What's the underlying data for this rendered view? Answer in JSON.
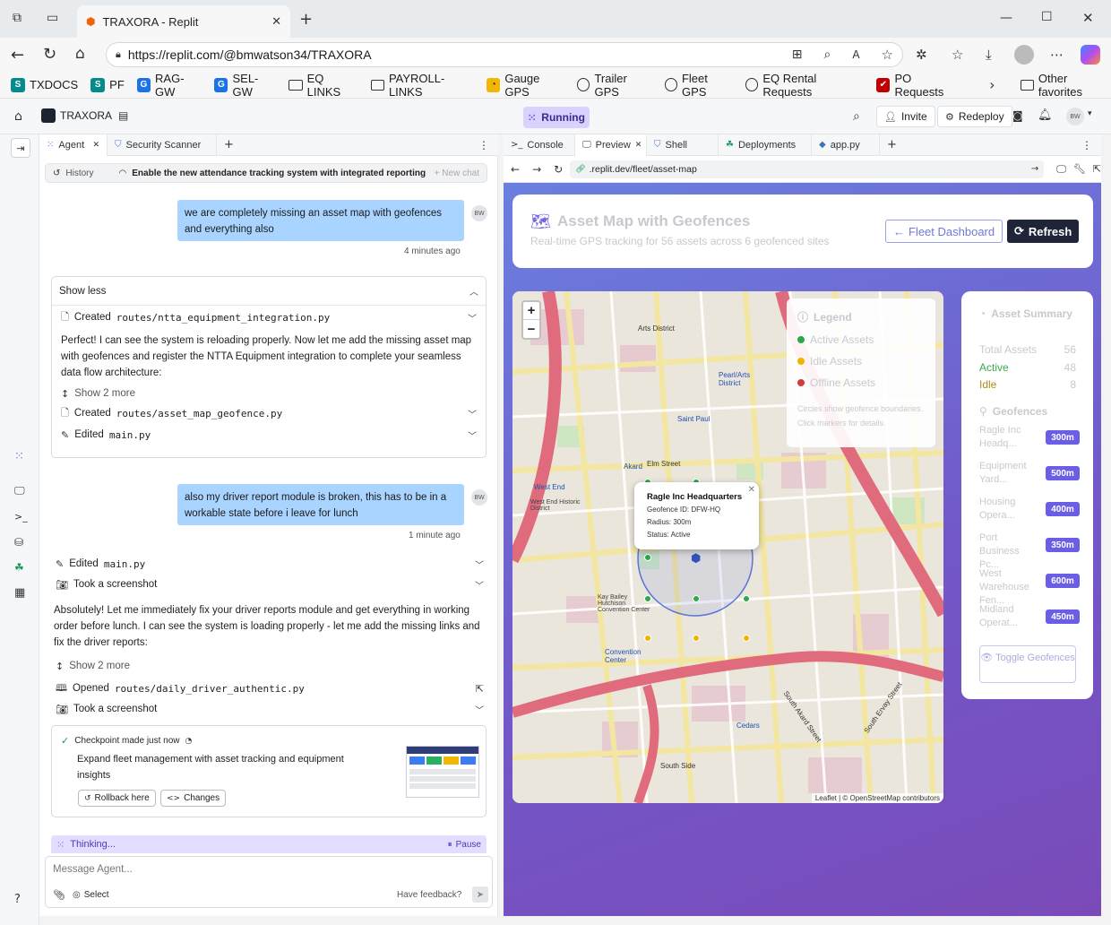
{
  "browser": {
    "tab_title": "TRAXORA - Replit",
    "url": "https://replit.com/@bmwatson34/TRAXORA",
    "favorites": [
      {
        "label": "TXDOCS",
        "icon": "sharepoint-icon"
      },
      {
        "label": "PF",
        "icon": "sharepoint-icon"
      },
      {
        "label": "RAG-GW",
        "icon": "g-icon"
      },
      {
        "label": "SEL-GW",
        "icon": "g-icon"
      },
      {
        "label": "EQ LINKS",
        "icon": "folder-icon"
      },
      {
        "label": "PAYROLL-LINKS",
        "icon": "folder-icon"
      },
      {
        "label": "Gauge GPS",
        "icon": "gauge-icon"
      },
      {
        "label": "Trailer GPS",
        "icon": "globe-icon"
      },
      {
        "label": "Fleet GPS",
        "icon": "globe-icon"
      },
      {
        "label": "EQ Rental Requests",
        "icon": "globe-icon"
      },
      {
        "label": "PO Requests",
        "icon": "po-icon"
      }
    ],
    "other_favorites": "Other favorites"
  },
  "replit": {
    "project": "TRAXORA",
    "status": "Running",
    "invite": "Invite",
    "redeploy": "Redeploy",
    "user_initials": "BW"
  },
  "agent": {
    "tabs": [
      {
        "label": "Agent"
      },
      {
        "label": "Security Scanner"
      }
    ],
    "history_label": "History",
    "history_title": "Enable the new attendance tracking system with integrated reporting",
    "new_chat": "+ New chat",
    "msg1": "we are completely missing an asset map with geofences and everything also",
    "msg1_time": "4 minutes ago",
    "show_less": "Show less",
    "created1": "Created",
    "created1_path": "routes/ntta_equipment_integration.py",
    "para1": "Perfect! I can see the system is reloading properly. Now let me add the missing asset map with geofences and register the NTTA Equipment integration to complete your seamless data flow architecture:",
    "show_more1": "Show 2 more",
    "created2": "Created",
    "created2_path": "routes/asset_map_geofence.py",
    "edited1": "Edited",
    "edited1_path": "main.py",
    "msg2": "also my driver report module is broken, this has to be in a workable state before i leave for lunch",
    "msg2_time": "1 minute ago",
    "edited2": "Edited",
    "edited2_path": "main.py",
    "screenshot1": "Took a screenshot",
    "para2": "Absolutely! Let me immediately fix your driver reports module and get everything in working order before lunch. I can see the system is loading properly - let me add the missing links and fix the driver reports:",
    "show_more2": "Show 2 more",
    "opened": "Opened",
    "opened_path": "routes/daily_driver_authentic.py",
    "screenshot2": "Took a screenshot",
    "checkpoint": "Checkpoint made just now",
    "checkpoint_desc": "Expand fleet management with asset tracking and equipment insights",
    "rollback": "Rollback here",
    "changes": "Changes",
    "thinking": "Thinking...",
    "pause": "Pause",
    "input_placeholder": "Message Agent...",
    "select": "Select",
    "feedback": "Have feedback?"
  },
  "preview": {
    "tabs": [
      {
        "label": "Console"
      },
      {
        "label": "Preview"
      },
      {
        "label": "Shell"
      },
      {
        "label": "Deployments"
      },
      {
        "label": "app.py"
      }
    ],
    "url": ".replit.dev/fleet/asset-map",
    "title": "Asset Map with Geofences",
    "subtitle": "Real-time GPS tracking for 56 assets across 6 geofenced sites",
    "fleet_dashboard": "Fleet Dashboard",
    "refresh": "Refresh",
    "legend": {
      "title": "Legend",
      "items": [
        {
          "label": "Active Assets",
          "color": "#2aa84a"
        },
        {
          "label": "Idle Assets",
          "color": "#f0b400"
        },
        {
          "label": "Offline Assets",
          "color": "#d63b3b"
        }
      ],
      "note": "Circles show geofence boundaries. Click markers for details."
    },
    "popup": {
      "title": "Ragle Inc Headquarters",
      "id": "Geofence ID: DFW-HQ",
      "radius": "Radius: 300m",
      "status": "Status: Active"
    },
    "map_labels": [
      "Arts District",
      "Pearl/Arts District",
      "Saint Paul",
      "Akard",
      "Elm Street",
      "West End",
      "West End Historic District",
      "Ragle Inc",
      "Kay Bailey Hutchison Convention Center",
      "Convention Center",
      "Cedars",
      "South Side",
      "South Ervay Street",
      "South Akard Street"
    ],
    "attribution": "Leaflet | © OpenStreetMap contributors",
    "summary": {
      "title": "Asset Summary",
      "total_label": "Total Assets",
      "total": "56",
      "active_label": "Active",
      "active": "48",
      "idle_label": "Idle",
      "idle": "8",
      "geofences_title": "Geofences",
      "geofences": [
        {
          "name": "Ragle Inc Headq...",
          "radius": "300m"
        },
        {
          "name": "Equipment Yard...",
          "radius": "500m"
        },
        {
          "name": "Housing Opera...",
          "radius": "400m"
        },
        {
          "name": "Port Business Pc...",
          "radius": "350m"
        },
        {
          "name": "West Warehouse Fen...",
          "radius": "600m"
        },
        {
          "name": "Midland Operat...",
          "radius": "450m"
        }
      ],
      "toggle": "Toggle Geofences"
    }
  }
}
